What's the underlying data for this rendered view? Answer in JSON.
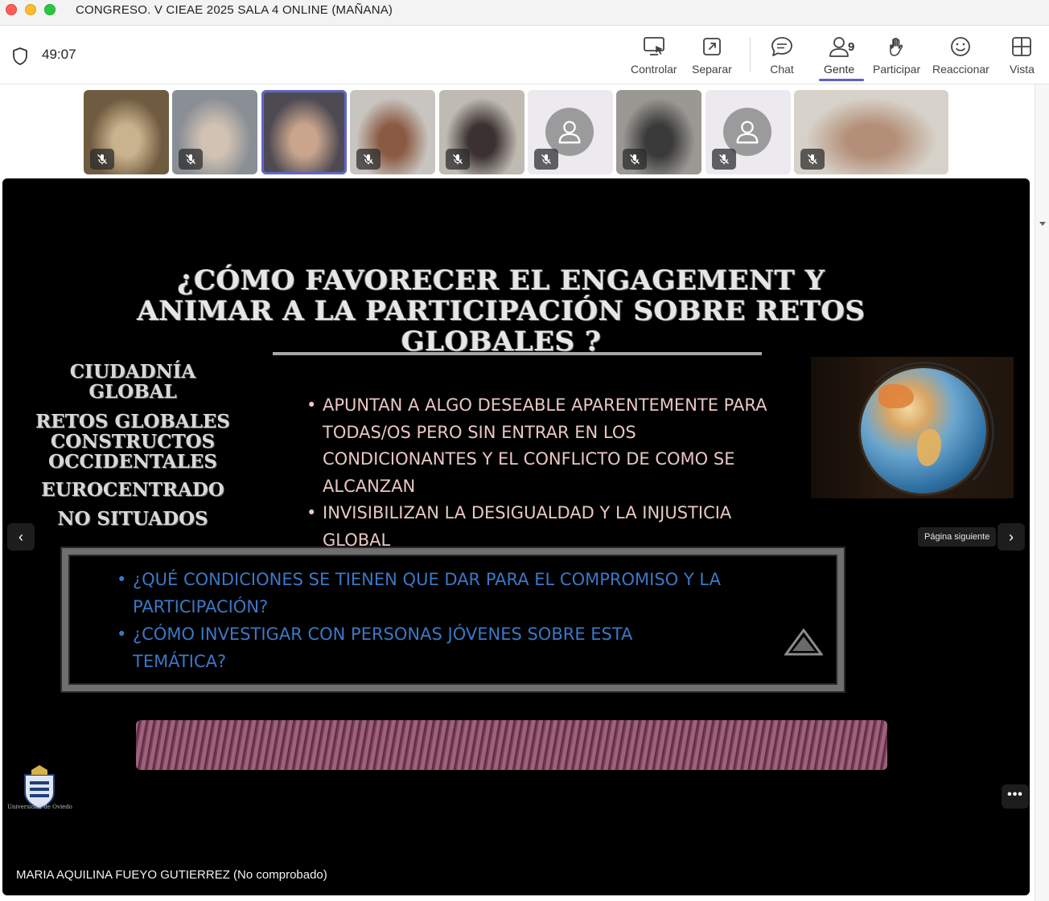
{
  "window": {
    "title": "CONGRESO. V CIEAE 2025 SALA 4 ONLINE (MAÑANA)"
  },
  "toolbar": {
    "timer": "49:07",
    "buttons": [
      {
        "label": "Controlar",
        "icon": "screen-control-icon"
      },
      {
        "label": "Separar",
        "icon": "pop-out-icon"
      },
      {
        "label": "Chat",
        "icon": "chat-icon"
      },
      {
        "label": "Gente",
        "icon": "people-icon",
        "count": "9",
        "active": true
      },
      {
        "label": "Participar",
        "icon": "raise-hand-icon"
      },
      {
        "label": "Reaccionar",
        "icon": "smiley-icon"
      },
      {
        "label": "Vista",
        "icon": "grid-view-icon"
      }
    ]
  },
  "participants": [
    {
      "type": "video",
      "muted": true,
      "colors": [
        "#6f5b3f",
        "#c9b28e"
      ]
    },
    {
      "type": "video",
      "muted": true,
      "colors": [
        "#8a8f96",
        "#d1c2b3"
      ]
    },
    {
      "type": "video",
      "muted": false,
      "active": true,
      "colors": [
        "#4e4a52",
        "#c9a58d"
      ]
    },
    {
      "type": "video",
      "muted": true,
      "colors": [
        "#c8c4bf",
        "#8a5a43"
      ]
    },
    {
      "type": "video",
      "muted": true,
      "colors": [
        "#bfbab2",
        "#3a3130"
      ]
    },
    {
      "type": "avatar",
      "muted": true
    },
    {
      "type": "video",
      "muted": true,
      "colors": [
        "#9a9893",
        "#3a3a3a"
      ]
    },
    {
      "type": "avatar",
      "muted": true
    },
    {
      "type": "video",
      "muted": true,
      "colors": [
        "#d7d2c9",
        "#b38f78"
      ]
    }
  ],
  "slide": {
    "title": "¿CÓMO FAVORECER EL ENGAGEMENT Y ANIMAR A LA PARTICIPACIÓN SOBRE RETOS GLOBALES ?",
    "concepts": [
      "CIUDADNÍA GLOBAL",
      "RETOS GLOBALES CONSTRUCTOS OCCIDENTALES",
      "EUROCENTRADO",
      "NO SITUADOS"
    ],
    "bullets": [
      "APUNTAN A ALGO DESEABLE APARENTEMENTE  PARA TODAS/OS PERO SIN ENTRAR EN LOS CONDICIONANTES Y EL CONFLICTO DE COMO SE ALCANZAN",
      "INVISIBILIZAN  LA DESIGUALDAD  Y LA INJUSTICIA GLOBAL"
    ],
    "questions": [
      "¿QUÉ CONDICIONES SE TIENEN QUE DAR PARA EL COMPROMISO Y LA PARTICIPACIÓN?",
      "¿CÓMO INVESTIGAR CON PERSONAS JÓVENES SOBRE ESTA TEMÁTICA?"
    ],
    "university_caption": "Universidad de Oviedo"
  },
  "stage": {
    "next_tooltip": "Página siguiente",
    "prev_glyph": "‹",
    "next_glyph": "›",
    "more_glyph": "•••",
    "presenter": "MARIA AQUILINA FUEYO GUTIERREZ (No comprobado)"
  },
  "colors": {
    "accent": "#5b5fc7",
    "slide_bullet_text": "#e8c7c2",
    "slide_question_text": "#3b78c6"
  }
}
